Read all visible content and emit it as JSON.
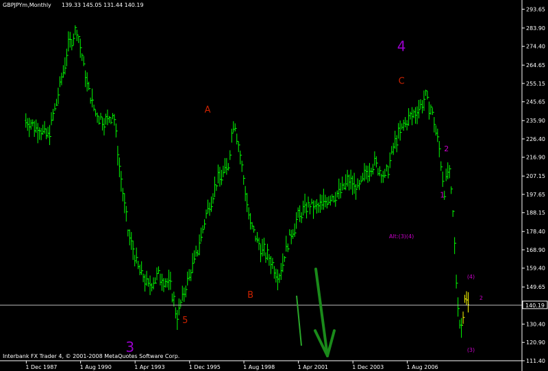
{
  "header": {
    "symbol_timeframe": "GBPJPYm,Monthly",
    "ohlc": "139.33 145.05 131.44 140.19"
  },
  "footer": {
    "copyright": "Interbank FX Trader 4, © 2001-2008 MetaQuotes Software Corp."
  },
  "current_price_label": "140.19",
  "colors": {
    "background": "#000000",
    "candles": "#00ff00",
    "recent_candles": "#ffff00",
    "axis_text": "#ffffff",
    "price_line": "#c0c0c0",
    "wave_red": "#cc2200",
    "wave_purple": "#9900cc",
    "wave_magenta": "#cc00cc",
    "arrow_green": "#1a8a1a"
  },
  "annotations": [
    {
      "text": "3",
      "color": "#9900cc",
      "size": "large"
    },
    {
      "text": "5",
      "color": "#cc2200",
      "size": "medium"
    },
    {
      "text": "A",
      "color": "#cc2200",
      "size": "medium"
    },
    {
      "text": "B",
      "color": "#cc2200",
      "size": "medium"
    },
    {
      "text": "C",
      "color": "#cc2200",
      "size": "medium"
    },
    {
      "text": "4",
      "color": "#9900cc",
      "size": "large"
    },
    {
      "text": "1",
      "color": "#cc00cc",
      "size": "small"
    },
    {
      "text": "2",
      "color": "#cc00cc",
      "size": "small"
    },
    {
      "text": "Alt:(3)(4)",
      "color": "#cc00cc",
      "size": "tiny"
    },
    {
      "text": "(4)",
      "color": "#cc00cc",
      "size": "tiny"
    },
    {
      "text": "(3)",
      "color": "#cc00cc",
      "size": "tiny"
    },
    {
      "text": "2",
      "color": "#cc00cc",
      "size": "tiny"
    }
  ],
  "chart_data": {
    "type": "bar",
    "series": [
      {
        "name": "GBPJPYm,Monthly",
        "points": [
          [
            1987.9,
            236
          ],
          [
            1988.5,
            232
          ],
          [
            1989.0,
            228
          ],
          [
            1989.5,
            250
          ],
          [
            1990.0,
            275
          ],
          [
            1990.4,
            283
          ],
          [
            1990.9,
            255
          ],
          [
            1991.3,
            240
          ],
          [
            1991.8,
            235
          ],
          [
            1992.2,
            240
          ],
          [
            1992.5,
            210
          ],
          [
            1992.9,
            178
          ],
          [
            1993.4,
            160
          ],
          [
            1993.9,
            150
          ],
          [
            1994.4,
            156
          ],
          [
            1995.0,
            150
          ],
          [
            1995.3,
            134
          ],
          [
            1995.8,
            152
          ],
          [
            1996.3,
            168
          ],
          [
            1996.8,
            190
          ],
          [
            1997.3,
            205
          ],
          [
            1997.8,
            212
          ],
          [
            1998.1,
            238
          ],
          [
            1998.5,
            210
          ],
          [
            1998.9,
            182
          ],
          [
            1999.4,
            170
          ],
          [
            1999.9,
            163
          ],
          [
            2000.3,
            155
          ],
          [
            2000.7,
            172
          ],
          [
            2001.2,
            185
          ],
          [
            2001.7,
            192
          ],
          [
            2002.2,
            190
          ],
          [
            2002.7,
            196
          ],
          [
            2003.2,
            198
          ],
          [
            2003.7,
            205
          ],
          [
            2004.2,
            200
          ],
          [
            2004.6,
            210
          ],
          [
            2005.0,
            214
          ],
          [
            2005.5,
            206
          ],
          [
            2006.0,
            225
          ],
          [
            2006.5,
            235
          ],
          [
            2007.0,
            240
          ],
          [
            2007.5,
            248
          ],
          [
            2007.8,
            240
          ],
          [
            2008.1,
            225
          ],
          [
            2008.4,
            200
          ],
          [
            2008.6,
            212
          ],
          [
            2008.8,
            190
          ],
          [
            2009.0,
            150
          ],
          [
            2009.2,
            125
          ],
          [
            2009.4,
            145
          ],
          [
            2009.6,
            140
          ]
        ]
      }
    ],
    "current_price": 140.19,
    "ylim": [
      111.4,
      297.0
    ],
    "y_ticks": [
      293.65,
      283.9,
      274.4,
      264.65,
      255.15,
      245.65,
      235.9,
      226.4,
      216.9,
      207.15,
      197.65,
      188.15,
      178.4,
      168.9,
      159.4,
      149.65,
      140.15,
      130.4,
      120.9,
      111.4
    ],
    "x_ticks": [
      {
        "label": "1 Dec 1987",
        "x": 1987.92
      },
      {
        "label": "1 Aug 1990",
        "x": 1990.58
      },
      {
        "label": "1 Apr 1993",
        "x": 1993.25
      },
      {
        "label": "1 Dec 1995",
        "x": 1995.92
      },
      {
        "label": "1 Aug 1998",
        "x": 1998.58
      },
      {
        "label": "1 Apr 2001",
        "x": 2001.25
      },
      {
        "label": "1 Dec 2003",
        "x": 2003.92
      },
      {
        "label": "1 Aug 2006",
        "x": 2006.58
      }
    ],
    "xlim": [
      1986.7,
      2012.2
    ],
    "annotation_positions": [
      [
        1993.0,
        116
      ],
      [
        1995.7,
        131
      ],
      [
        1996.8,
        240
      ],
      [
        1998.9,
        144
      ],
      [
        2006.3,
        255
      ],
      [
        2006.3,
        272
      ],
      [
        2008.3,
        196
      ],
      [
        2008.5,
        220
      ],
      [
        2006.3,
        175
      ],
      [
        2009.7,
        154
      ],
      [
        2009.7,
        116
      ],
      [
        2010.2,
        143
      ]
    ],
    "grid": false
  }
}
